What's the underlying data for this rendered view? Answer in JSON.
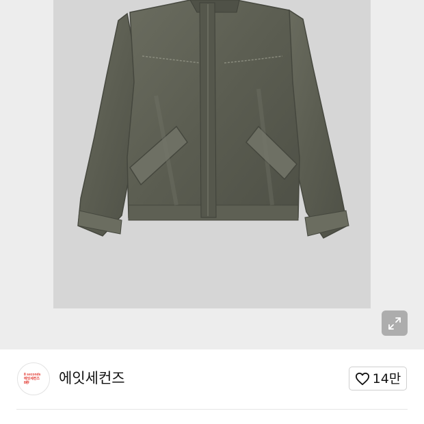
{
  "product": {
    "image_icon": "jacket-photo",
    "expand_icon": "expand-arrows-icon"
  },
  "brand": {
    "logo_lines": [
      "8 seconds",
      "에잇세컨즈",
      "8秒"
    ],
    "logo_color": "#e23a32",
    "name": "에잇세컨즈"
  },
  "like": {
    "icon": "heart-outline-icon",
    "count": "14만"
  }
}
